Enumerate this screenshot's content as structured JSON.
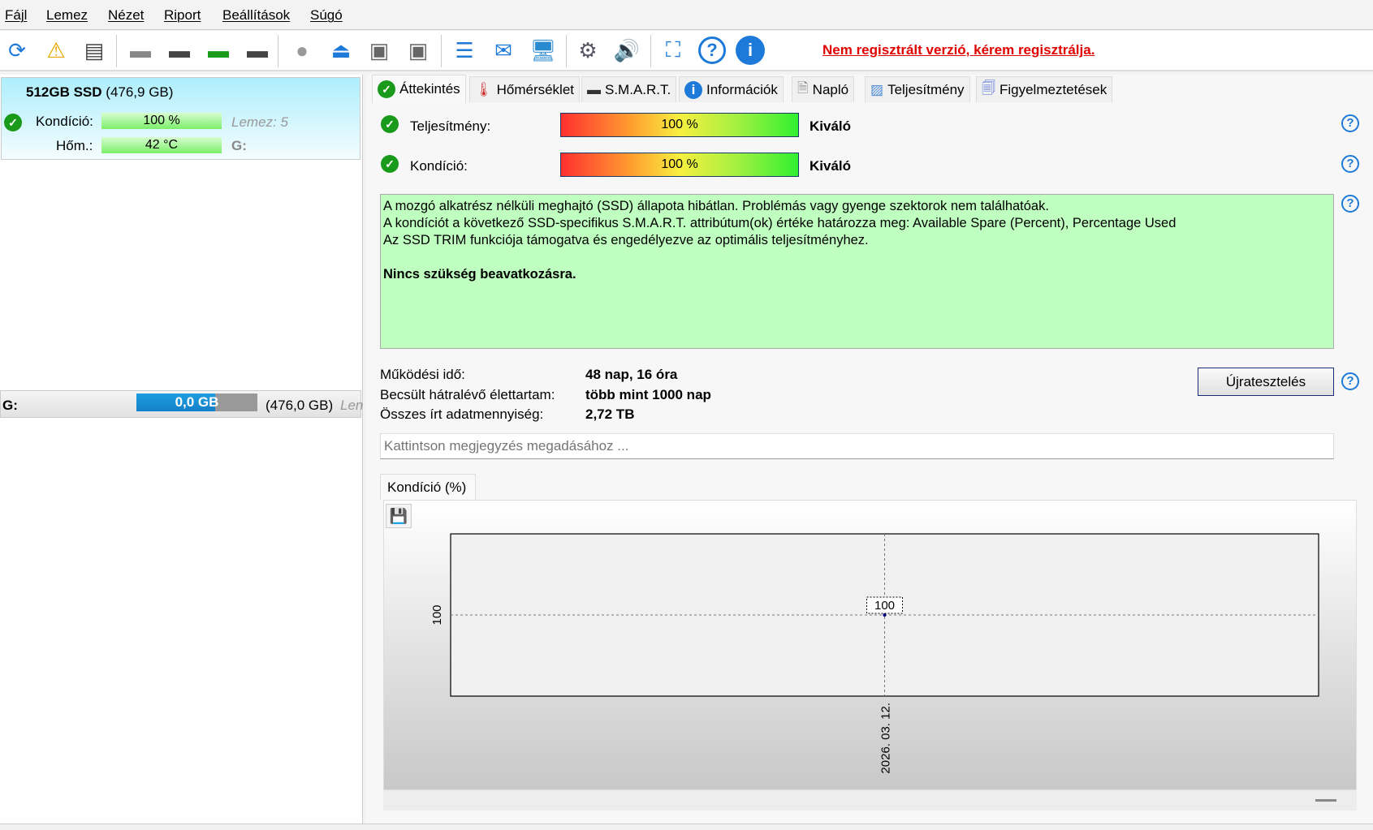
{
  "menu": [
    "Fájl",
    "Lemez",
    "Nézet",
    "Riport",
    "Beállítások",
    "Súgó"
  ],
  "toolbar": {
    "icons": [
      "refresh-icon",
      "refresh-warning-icon",
      "disk-list-icon",
      "disk-sound-icon",
      "disk-clock-icon",
      "disk-check-icon",
      "disk-search-icon",
      "disk-gray-icon",
      "eject-icon",
      "hotswap-icon",
      "hotswap-remove-icon",
      "notepad-icon",
      "mail-icon",
      "web-icon",
      "settings-icon",
      "speaker-icon",
      "screenshot-icon",
      "help-icon",
      "info-icon"
    ],
    "register_warning": "Nem regisztrált verzió, kérem regisztrálja."
  },
  "disk": {
    "name": "512GB SSD",
    "size": "(476,9 GB)",
    "condition_label": "Kondíció:",
    "condition_value": "100 %",
    "temp_label": "Hőm.:",
    "temp_value": "42 °C",
    "disk_index": "Lemez: 5",
    "drive": "G:"
  },
  "partition": {
    "drive": "G:",
    "used": "0,0 GB",
    "used_fraction": 0.0,
    "total": "(476,0 GB)",
    "extra": "Len"
  },
  "tabs": [
    "Áttekintés",
    "Hőmérséklet",
    "S.M.A.R.T.",
    "Információk",
    "Napló",
    "Teljesítmény",
    "Figyelmeztetések"
  ],
  "overview": {
    "performance_label": "Teljesítmény:",
    "performance_value": "100 %",
    "performance_percent": 100,
    "performance_rating": "Kiváló",
    "condition_label": "Kondíció:",
    "condition_value": "100 %",
    "condition_percent": 100,
    "condition_rating": "Kiváló",
    "message_lines": [
      "A mozgó alkatrész nélküli meghajtó (SSD) állapota hibátlan. Problémás vagy gyenge szektorok nem találhatóak.",
      "A kondíciót a következő SSD-specifikus S.M.A.R.T. attribútum(ok) értéke határozza meg:  Available Spare (Percent), Percentage Used",
      "Az SSD TRIM funkciója támogatva és engedélyezve az optimális teljesítményhez."
    ],
    "message_action": "Nincs szükség beavatkozásra.",
    "uptime_label": "Működési idő:",
    "uptime_value": "48 nap, 16 óra",
    "lifetime_label": "Becsült hátralévő élettartam:",
    "lifetime_value": "több mint 1000 nap",
    "written_label": "Összes írt adatmennyiség:",
    "written_value": "2,72 TB",
    "retest_label": "Újratesztelés",
    "note_placeholder": "Kattintson megjegyzés megadásához ..."
  },
  "chart_tab": "Kondíció  (%)",
  "chart_data": {
    "type": "line",
    "x": [
      "2026. 03. 12."
    ],
    "series": [
      {
        "values": [
          100
        ]
      }
    ],
    "ytick_labels": [
      "100"
    ],
    "xtick_labels": [
      "2026. 03. 12."
    ],
    "data_labels": [
      "100"
    ],
    "grid": true,
    "color": "#000080"
  }
}
